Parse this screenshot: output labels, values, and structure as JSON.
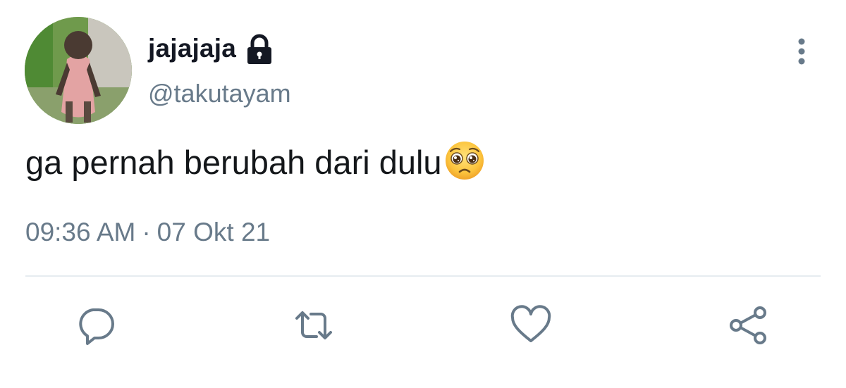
{
  "user": {
    "display_name": "jajajaja",
    "handle": "@takutayam",
    "protected": true
  },
  "tweet": {
    "text": "ga pernah berubah dari dulu",
    "emoji": "pleading-face",
    "time": "09:36 AM",
    "separator": "·",
    "date": "07 Okt 21"
  },
  "actions": [
    "reply",
    "retweet",
    "like",
    "share"
  ],
  "colors": {
    "text": "#14171a",
    "secondary": "#687a8a",
    "divider": "#e6ecf0"
  }
}
